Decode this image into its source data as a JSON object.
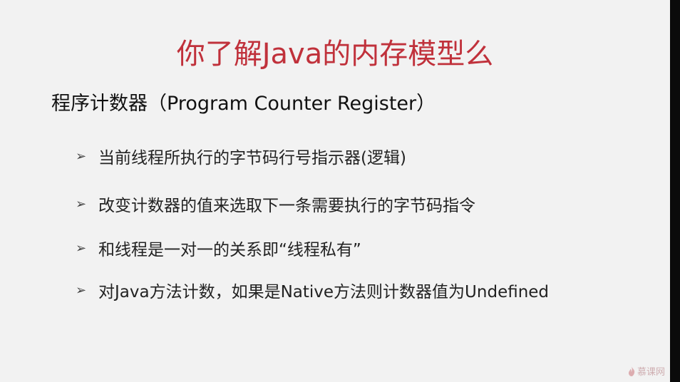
{
  "slide": {
    "title": "你了解Java的内存模型么",
    "subtitle": "程序计数器（Program Counter Register）",
    "bullets": [
      {
        "icon": "chevron-right-icon",
        "text": "当前线程所执行的字节码行号指示器(逻辑)"
      },
      {
        "icon": "chevron-right-icon",
        "text": "改变计数器的值来选取下一条需要执行的字节码指令"
      },
      {
        "icon": "chevron-right-icon",
        "text": "和线程是一对一的关系即“线程私有”"
      },
      {
        "icon": "chevron-right-icon",
        "text": "对Java方法计数，如果是Native方法则计数器值为Undefined"
      }
    ],
    "arrow_glyph": "➢"
  },
  "watermark": {
    "text": "慕课网",
    "icon": "flame-logo-icon"
  },
  "colors": {
    "title": "#c0313b",
    "background": "#f2f2f2",
    "text": "#222222"
  }
}
